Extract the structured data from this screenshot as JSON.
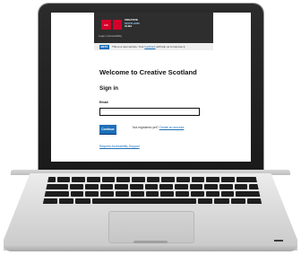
{
  "header": {
    "logo_mark": "CA",
    "logo_line1": "CREATIVE",
    "logo_line2": "SCOTLAND",
    "logo_line3": "ALBA",
    "nav_text": "Login | Accessibility"
  },
  "beta": {
    "tag": "BETA",
    "text_before": "This is a new service. Your",
    "link": "feedback",
    "text_after": "will help us to improve it."
  },
  "main": {
    "title": "Welcome to Creative Scotland",
    "subtitle": "Sign in",
    "email_label": "Email",
    "email_value": "",
    "continue_label": "Continue",
    "register_prompt": "Not registered yet?",
    "register_link": "Create an account",
    "accessibility_link": "Request Accessibility Support"
  },
  "colors": {
    "header_bg": "#2e2e2e",
    "brand_red": "#d4002a",
    "link_blue": "#1d70b8",
    "button_blue": "#1d70b8"
  }
}
